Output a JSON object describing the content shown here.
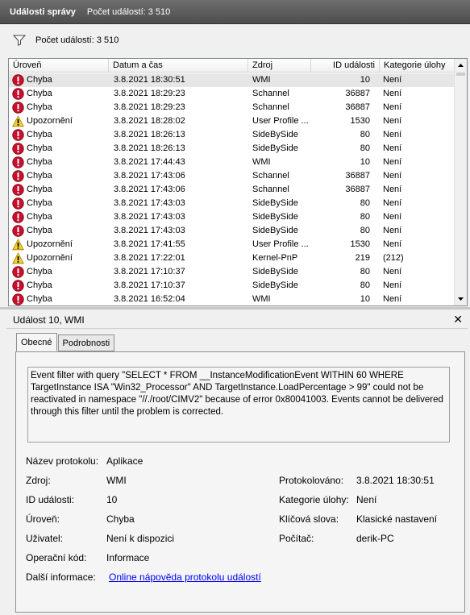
{
  "titlebar": {
    "title": "Události správy",
    "count": "Počet událostí: 3 510"
  },
  "filter": {
    "count": "Počet událostí: 3 510"
  },
  "columns": [
    "Úroveň",
    "Datum a čas",
    "Zdroj",
    "ID události",
    "Kategorie úlohy"
  ],
  "rows": [
    {
      "level": "Chyba",
      "icon": "error-icon",
      "date": "3.8.2021 18:30:51",
      "source": "WMI",
      "id": "10",
      "category": "Není"
    },
    {
      "level": "Chyba",
      "icon": "error-icon",
      "date": "3.8.2021 18:29:23",
      "source": "Schannel",
      "id": "36887",
      "category": "Není"
    },
    {
      "level": "Chyba",
      "icon": "error-icon",
      "date": "3.8.2021 18:29:23",
      "source": "Schannel",
      "id": "36887",
      "category": "Není"
    },
    {
      "level": "Upozornění",
      "icon": "warning-icon",
      "date": "3.8.2021 18:28:02",
      "source": "User Profile ...",
      "id": "1530",
      "category": "Není"
    },
    {
      "level": "Chyba",
      "icon": "error-icon",
      "date": "3.8.2021 18:26:13",
      "source": "SideBySide",
      "id": "80",
      "category": "Není"
    },
    {
      "level": "Chyba",
      "icon": "error-icon",
      "date": "3.8.2021 18:26:13",
      "source": "SideBySide",
      "id": "80",
      "category": "Není"
    },
    {
      "level": "Chyba",
      "icon": "error-icon",
      "date": "3.8.2021 17:44:43",
      "source": "WMI",
      "id": "10",
      "category": "Není"
    },
    {
      "level": "Chyba",
      "icon": "error-icon",
      "date": "3.8.2021 17:43:06",
      "source": "Schannel",
      "id": "36887",
      "category": "Není"
    },
    {
      "level": "Chyba",
      "icon": "error-icon",
      "date": "3.8.2021 17:43:06",
      "source": "Schannel",
      "id": "36887",
      "category": "Není"
    },
    {
      "level": "Chyba",
      "icon": "error-icon",
      "date": "3.8.2021 17:43:03",
      "source": "SideBySide",
      "id": "80",
      "category": "Není"
    },
    {
      "level": "Chyba",
      "icon": "error-icon",
      "date": "3.8.2021 17:43:03",
      "source": "SideBySide",
      "id": "80",
      "category": "Není"
    },
    {
      "level": "Chyba",
      "icon": "error-icon",
      "date": "3.8.2021 17:43:03",
      "source": "SideBySide",
      "id": "80",
      "category": "Není"
    },
    {
      "level": "Upozornění",
      "icon": "warning-icon",
      "date": "3.8.2021 17:41:55",
      "source": "User Profile ...",
      "id": "1530",
      "category": "Není"
    },
    {
      "level": "Upozornění",
      "icon": "warning-icon",
      "date": "3.8.2021 17:22:01",
      "source": "Kernel-PnP",
      "id": "219",
      "category": "(212)"
    },
    {
      "level": "Chyba",
      "icon": "error-icon",
      "date": "3.8.2021 17:10:37",
      "source": "SideBySide",
      "id": "80",
      "category": "Není"
    },
    {
      "level": "Chyba",
      "icon": "error-icon",
      "date": "3.8.2021 17:10:37",
      "source": "SideBySide",
      "id": "80",
      "category": "Není"
    },
    {
      "level": "Chyba",
      "icon": "error-icon",
      "date": "3.8.2021 16:52:04",
      "source": "WMI",
      "id": "10",
      "category": "Není"
    }
  ],
  "detail": {
    "title": "Událost 10, WMI",
    "tabs": [
      "Obecné",
      "Podrobnosti"
    ],
    "description": "Event filter with query \"SELECT * FROM __InstanceModificationEvent WITHIN 60 WHERE TargetInstance ISA \"Win32_Processor\" AND TargetInstance.LoadPercentage > 99\" could not be reactivated in namespace \"//./root/CIMV2\" because of error 0x80041003. Events cannot be delivered through this filter until the problem is corrected.",
    "fields": {
      "log_name_label": "Název protokolu:",
      "log_name": "Aplikace",
      "source_label": "Zdroj:",
      "source": "WMI",
      "logged_label": "Protokolováno:",
      "logged": "3.8.2021 18:30:51",
      "event_id_label": "ID události:",
      "event_id": "10",
      "task_category_label": "Kategorie úlohy:",
      "task_category": "Není",
      "level_label": "Úroveň:",
      "level": "Chyba",
      "keywords_label": "Klíčová slova:",
      "keywords": "Klasické nastavení",
      "user_label": "Uživatel:",
      "user": "Není k dispozici",
      "computer_label": "Počítač:",
      "computer": "derik-PC",
      "opcode_label": "Operační kód:",
      "opcode": "Informace",
      "more_info_label": "Další informace:",
      "more_info_link": "Online nápověda protokolu událostí"
    }
  }
}
